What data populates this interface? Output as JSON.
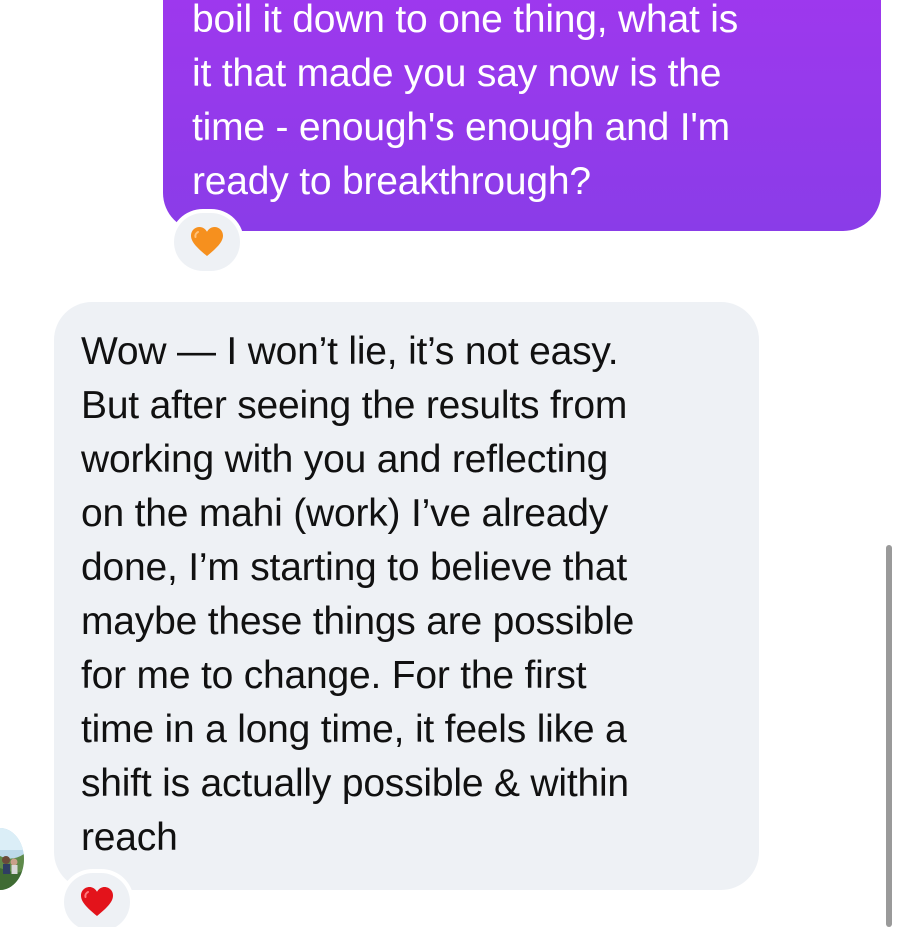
{
  "messages": [
    {
      "direction": "sent",
      "text": "boil it down to one thing, what is\nit that made you say now is the\ntime - enough's enough and I'm\nready to breakthrough?",
      "reaction": "orange-heart-icon"
    },
    {
      "direction": "received",
      "text": "Wow — I won’t lie, it’s not easy.\nBut after seeing the results from\nworking with you and reflecting\non the mahi (work) I’ve already\ndone, I’m starting to believe that\nmaybe these things are possible\nfor me to change. For the first\ntime in a long time, it feels like a\nshift is actually possible & within\nreach",
      "reaction": "red-heart-icon"
    }
  ],
  "colors": {
    "sent_bubble": "#9138ec",
    "received_bubble": "#eef1f5",
    "orange_heart": "#f6901e",
    "red_heart": "#e3131b"
  }
}
